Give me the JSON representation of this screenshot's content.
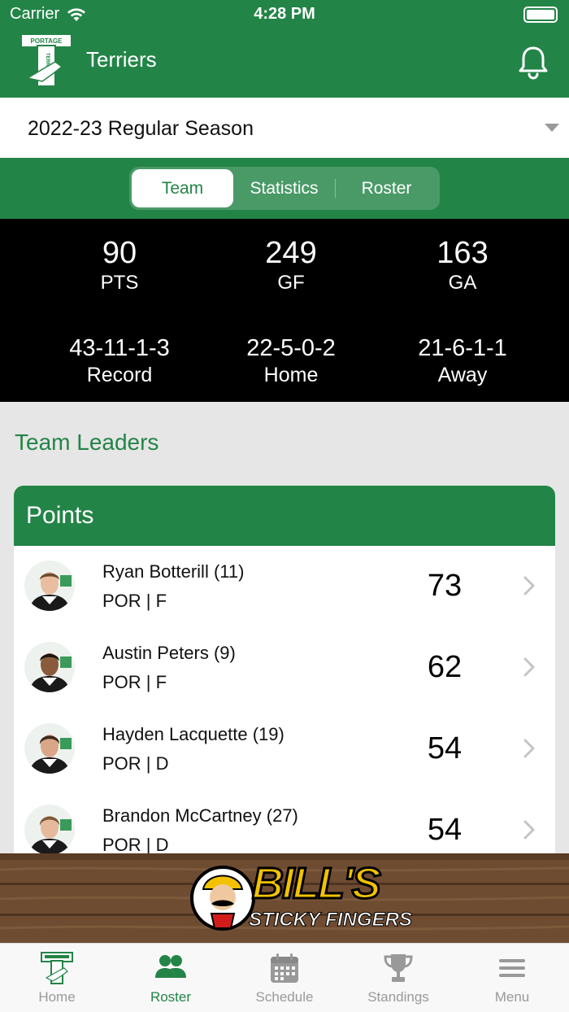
{
  "status_bar": {
    "carrier": "Carrier",
    "time": "4:28 PM"
  },
  "header": {
    "title": "Terriers",
    "logo_lines": [
      "PORTAGE",
      "TERRIERS"
    ]
  },
  "season": {
    "selected": "2022-23 Regular Season"
  },
  "tabs": [
    {
      "label": "Team",
      "active": true
    },
    {
      "label": "Statistics",
      "active": false
    },
    {
      "label": "Roster",
      "active": false
    }
  ],
  "stats": {
    "pts": {
      "value": "90",
      "label": "PTS"
    },
    "gf": {
      "value": "249",
      "label": "GF"
    },
    "ga": {
      "value": "163",
      "label": "GA"
    },
    "record": {
      "value": "43-11-1-3",
      "label": "Record"
    },
    "home": {
      "value": "22-5-0-2",
      "label": "Home"
    },
    "away": {
      "value": "21-6-1-1",
      "label": "Away"
    }
  },
  "leaders": {
    "section_title": "Team Leaders",
    "card_title": "Points",
    "rows": [
      {
        "name": "Ryan Botterill (11)",
        "meta": "POR | F",
        "value": "73"
      },
      {
        "name": "Austin Peters (9)",
        "meta": "POR | F",
        "value": "62"
      },
      {
        "name": "Hayden Lacquette (19)",
        "meta": "POR | D",
        "value": "54"
      },
      {
        "name": "Brandon McCartney (27)",
        "meta": "POR | D",
        "value": "54"
      }
    ]
  },
  "ad": {
    "line1": "BILL'S",
    "line2": "STICKY FINGERS"
  },
  "tab_bar": [
    {
      "label": "Home",
      "icon": "team-logo-icon",
      "active": false
    },
    {
      "label": "Roster",
      "icon": "people-icon",
      "active": true
    },
    {
      "label": "Schedule",
      "icon": "calendar-icon",
      "active": false
    },
    {
      "label": "Standings",
      "icon": "trophy-icon",
      "active": false
    },
    {
      "label": "Menu",
      "icon": "hamburger-icon",
      "active": false
    }
  ],
  "colors": {
    "brand_green": "#238447",
    "stats_bg": "#000000",
    "inactive_tab": "#999999"
  }
}
